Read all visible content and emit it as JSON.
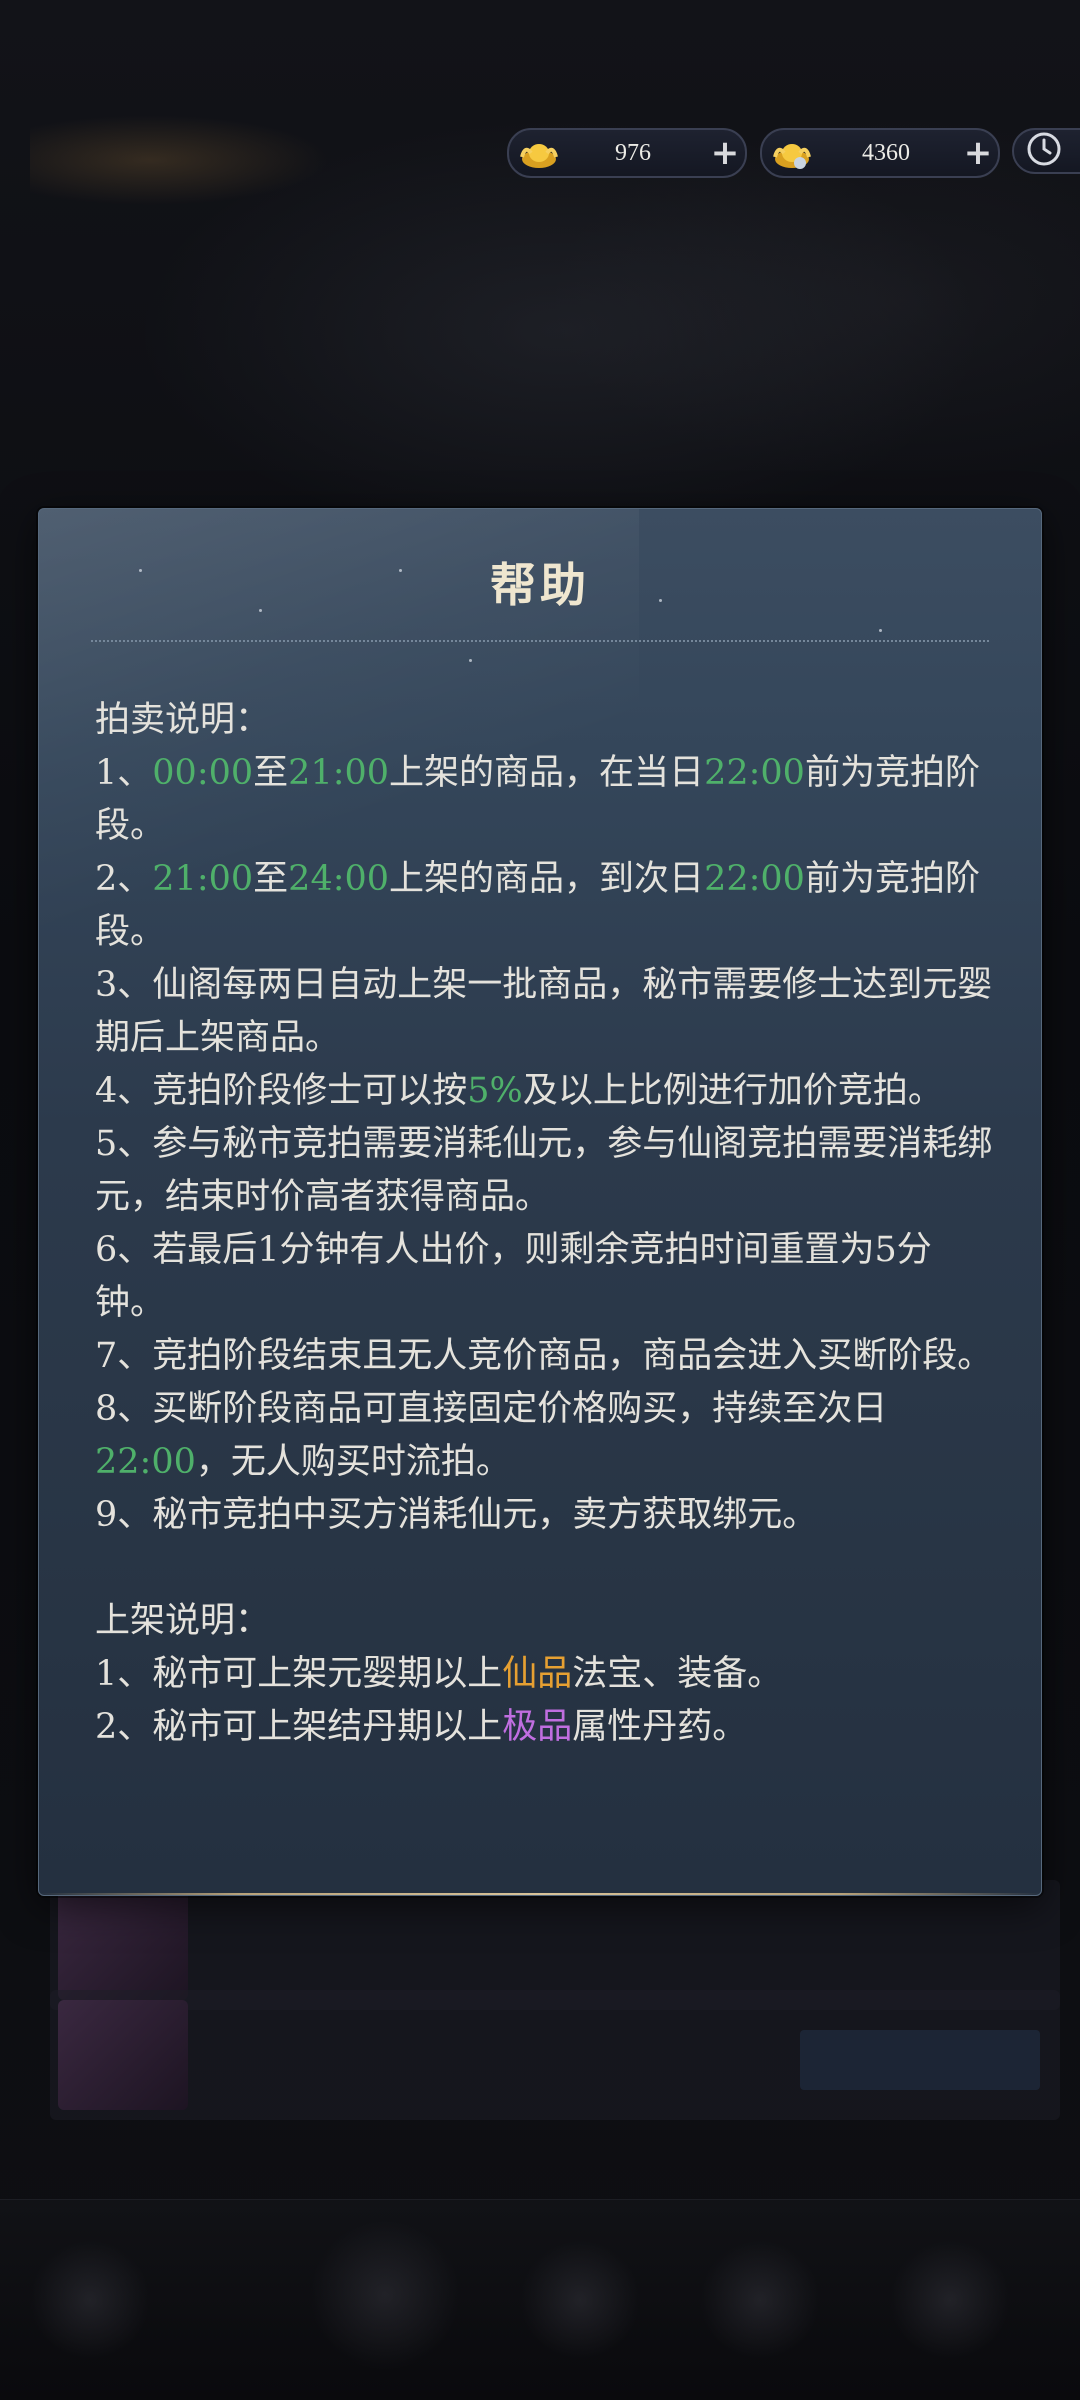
{
  "currency": [
    {
      "icon": "gold-ingot-icon",
      "amount": "976",
      "add": "+"
    },
    {
      "icon": "bound-gold-ingot-icon",
      "amount": "4360",
      "add": "+"
    }
  ],
  "clock": {
    "icon": "clock-icon"
  },
  "dialog": {
    "title": "帮助",
    "auction_heading": "拍卖说明：",
    "rule1": [
      "1、",
      "00:00",
      "至",
      "21:00",
      "上架的商品，在当日",
      "22:00",
      "前为竞拍阶段。"
    ],
    "rule2": [
      "2、",
      "21:00",
      "至",
      "24:00",
      "上架的商品，到次日",
      "22:00",
      "前为竞拍阶段。"
    ],
    "rule3": "3、仙阁每两日自动上架一批商品，秘市需要修士达到元婴期后上架商品。",
    "rule4": [
      "4、竞拍阶段修士可以按",
      "5%",
      "及以上比例进行加价竞拍。"
    ],
    "rule5": "5、参与秘市竞拍需要消耗仙元，参与仙阁竞拍需要消耗绑元，结束时价高者获得商品。",
    "rule6": "6、若最后1分钟有人出价，则剩余竞拍时间重置为5分钟。",
    "rule7": "7、竞拍阶段结束且无人竞价商品，商品会进入买断阶段。",
    "rule8": [
      "8、买断阶段商品可直接固定价格购买，持续至次日",
      "22:00",
      "，无人购买时流拍。"
    ],
    "rule9": "9、秘市竞拍中买方消耗仙元，卖方获取绑元。",
    "listing_heading": "上架说明：",
    "listing1": [
      "1、秘市可上架元婴期以上",
      "仙品",
      "法宝、装备。"
    ],
    "listing2": [
      "2、秘市可上架结丹期以上",
      "极品",
      "属性丹药。"
    ],
    "colors": {
      "time": "#4fb06a",
      "immortal_grade": "#e6a032",
      "supreme_grade": "#c06ee0"
    }
  }
}
